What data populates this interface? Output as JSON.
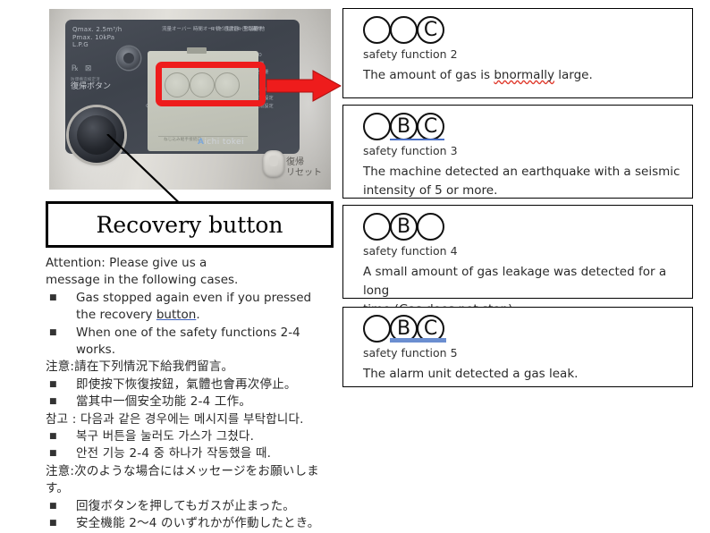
{
  "device": {
    "spec_text": "Qmax. 2.5m³/h\nPmax. 10kPa\nL.P.G",
    "marks": "℞ ⊠",
    "marks_sub": "防爆構造検定済",
    "recover_label": "復帰ボタン",
    "led_column_1": "流量オーバー\n時間オーバー\n感震器・警報器 他",
    "led_column_2": "R  微少もれ\nR  圧力異常",
    "mid_labels": "微少\n上限\n\n下限\n合算\nA切上\nCX対応",
    "right_labels": "CO\n流量\n使用量\n\nスイッチ1-2\n下限設定\n上限設定",
    "brand_mark": "A",
    "brand_name": "ichi tokei",
    "lcd_bottom_text": "ねじ込み継手接続口",
    "reset_text": "復帰\nリセット"
  },
  "recovery_caption": {
    "label": "Recovery button"
  },
  "left_text": {
    "attention_line1": "Attention: Please give us a",
    "attention_line2": "message in the following cases.",
    "bullet_mark": "■",
    "en_bullet_1a": "Gas stopped again even if you pressed",
    "en_bullet_1b_pre": "the recovery ",
    "en_bullet_1b_link": "button",
    "en_bullet_1b_post": ".",
    "en_bullet_2a": "When one of the safety functions 2-4",
    "en_bullet_2b": "works.",
    "zh_heading": "注意:請在下列情況下給我們留言。",
    "zh_bullet_1": "即使按下恢復按鈕，氣體也會再次停止。",
    "zh_bullet_2": "當其中一個安全功能 2-4 工作。",
    "ko_heading": "참고 : 다음과 같은 경우에는 메시지를 부탁합니다.",
    "ko_bullet_1": "복구 버튼을 눌러도 가스가 그쳤다.",
    "ko_bullet_2": "안전 기능 2-4 중 하나가 작동했을 때.",
    "ja_heading": "注意:次のような場合にはメッセージをお願いします。",
    "ja_bullet_1": "回復ボタンを押してもガスが止まった。",
    "ja_bullet_2": "安全機能 2〜4 のいずれかが作動したとき。"
  },
  "safety_functions": [
    {
      "circles": [
        "",
        "",
        "C"
      ],
      "underline": "none",
      "label": "safety function 2",
      "desc_pre": "The amount of gas  is ",
      "desc_err": "bnormally",
      "desc_post": " large.",
      "desc_line2": ""
    },
    {
      "circles": [
        "",
        "B",
        "C"
      ],
      "underline": "thin",
      "label": "safety function 3",
      "desc_pre": "The machine detected  an earthquake with a seismic",
      "desc_err": "",
      "desc_post": "",
      "desc_line2": "intensity  of 5 or more."
    },
    {
      "circles": [
        "",
        "B",
        ""
      ],
      "underline": "none",
      "label": "safety function 4",
      "desc_pre": "A small amount of gas leakage was detected for a long",
      "desc_err": "",
      "desc_post": "",
      "desc_line2_link": "time.",
      "desc_line2": "(Gas does not stop)"
    },
    {
      "circles": [
        "",
        "B",
        "C"
      ],
      "underline": "thick",
      "label": "safety function 5",
      "desc_pre": "The alarm unit detected a gas leak.",
      "desc_err": "",
      "desc_post": "",
      "desc_line2": ""
    }
  ],
  "colors": {
    "highlight_red": "#ee1c1c",
    "underline_blue": "#4a6fc4",
    "spellcheck_red": "#e03b2e"
  }
}
